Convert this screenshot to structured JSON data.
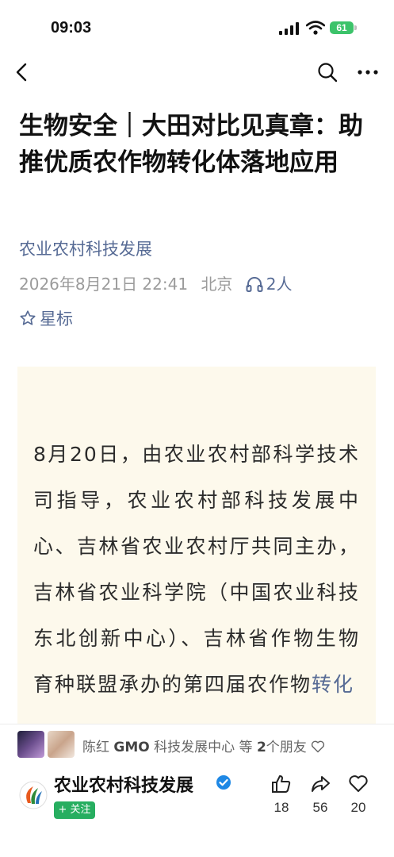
{
  "status_bar": {
    "time": "09:03",
    "battery": "61"
  },
  "article": {
    "title": "生物安全｜大田对比见真章：助推优质农作物转化体落地应用",
    "account": "农业农村科技发展",
    "date": "2026年8月21日 22:41",
    "location": "北京",
    "listeners": "2人",
    "star_label": "星标",
    "body_text": "8月20日，由农业农村部科学技术司指导，农业农村部科技发展中心、吉林省农业农村厅共同主办，吉林省农业科学院（中国农业科技东北创新中心）、吉林省作物生物育种联盟承办的第四届农作物",
    "body_link": "转化"
  },
  "friends_bar": {
    "text_prefix": "陈红",
    "text_bold": "GMO",
    "text_suffix": "科技发展中心 等",
    "count": "2",
    "tail": "个朋友"
  },
  "footer": {
    "account_name": "农业农村科技发展",
    "follow_label": "+ 关注",
    "likes": "18",
    "shares": "56",
    "hearts": "20"
  },
  "colors": {
    "link": "#576b95",
    "content_bg": "#fdf9ec",
    "follow": "#27ae60",
    "verified": "#1e88e5"
  }
}
